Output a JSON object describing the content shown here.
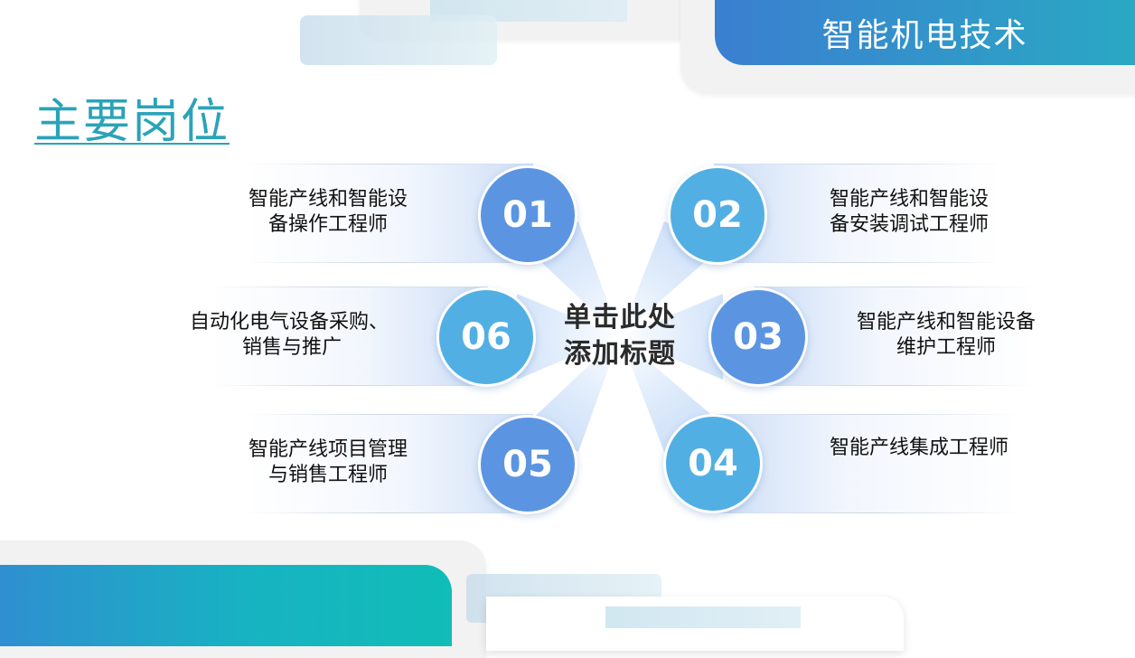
{
  "header": {
    "title": "智能机电技术"
  },
  "heading": "主要岗位",
  "center": {
    "line1": "单击此处",
    "line2": "添加标题"
  },
  "items": [
    {
      "num": "01",
      "line1": "智能产线和智能设",
      "line2": "备操作工程师"
    },
    {
      "num": "02",
      "line1": "智能产线和智能设",
      "line2": "备安装调试工程师"
    },
    {
      "num": "03",
      "line1": "智能产线和智能设备",
      "line2": "维护工程师"
    },
    {
      "num": "04",
      "line1": "智能产线集成工程师",
      "line2": ""
    },
    {
      "num": "05",
      "line1": "智能产线项目管理",
      "line2": "与销售工程师"
    },
    {
      "num": "06",
      "line1": "自动化电气设备采购、",
      "line2": "销售与推广"
    }
  ],
  "colors": {
    "accent": "#2aa3b8",
    "circle_blue": "#5b95e2",
    "circle_cyan": "#52afe4"
  }
}
